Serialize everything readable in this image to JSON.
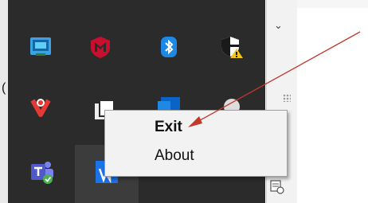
{
  "context_menu": {
    "items": [
      {
        "label": "Exit",
        "bold": true
      },
      {
        "label": "About",
        "bold": false
      }
    ]
  },
  "background": {
    "partial_char": "("
  },
  "tray": {
    "icons": [
      {
        "name": "remote-desktop-icon"
      },
      {
        "name": "mcafee-icon"
      },
      {
        "name": "bluetooth-icon"
      },
      {
        "name": "security-warning-icon"
      },
      {
        "name": "vpn-icon"
      },
      {
        "name": "app-icon"
      },
      {
        "name": "outlook-icon"
      },
      {
        "name": "app-icon-2"
      },
      {
        "name": "teams-icon"
      },
      {
        "name": "app-blue-icon"
      }
    ]
  },
  "colors": {
    "tray_bg": "#2b2b2b",
    "menu_bg": "#f2f2f2",
    "arrow": "#c0392b"
  }
}
